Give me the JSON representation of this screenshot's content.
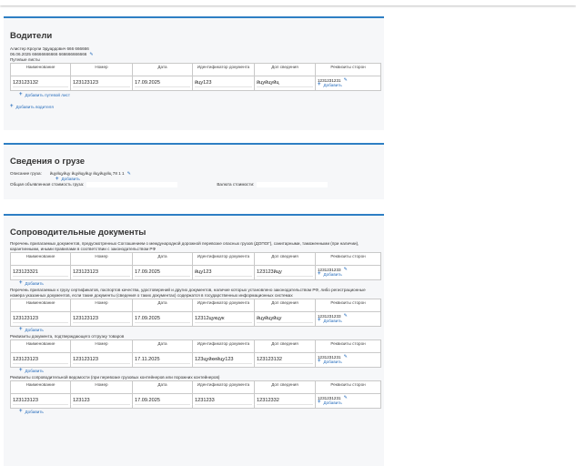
{
  "drivers": {
    "title": "Водители",
    "driver_name": "Алистер Кроули Эдуардович 666 666666",
    "driver_details": "06.06.2025 66666666666 666666666666",
    "waybills_label": "Путевые листы",
    "columns": [
      "Наименование",
      "Номер",
      "Дата",
      "Идентификатор документа",
      "Доп сведения",
      "Реквизиты сторон"
    ],
    "rows": [
      {
        "name": "123123132",
        "number": "123123123",
        "date": "17.09.2025",
        "ident": "йцу123",
        "extra": "йцуйцуйц",
        "req": "1231231231"
      }
    ],
    "add_inline": "Добавить",
    "add_waybill": "Добавить путевой лист",
    "add_driver": "Добавить водителя"
  },
  "cargo": {
    "title": "Сведения о грузе",
    "desc_label": "Описание груза:",
    "desc_value": "йцуйцуйцу йцуйцуйцу йцуйцуйц 78 1 1",
    "add_link": "Добавить",
    "value_label": "Общая объявленная стоимость груза:",
    "currency_label": "Валюта стоимости:"
  },
  "docs": {
    "title": "Сопроводительные документы",
    "columns": [
      "Наименование",
      "Номер",
      "Дата",
      "Идентификатор документа",
      "Доп сведения",
      "Реквизиты сторон"
    ],
    "add_inline": "Добавить",
    "add_link": "Добавить",
    "groups": [
      {
        "desc": "Перечень прилагаемых документов, предусмотренных Соглашением о международной дорожной перевозке опасных грузов (ДОПОГ), санитарными, таможенными (при наличии), карантинными, иными правилами в соответствии с законодательством РФ",
        "rows": [
          {
            "name": "123123321",
            "number": "123123123",
            "date": "17.09.2025",
            "ident": "йцу123",
            "extra": "123123йцу",
            "req": "1231231233"
          }
        ]
      },
      {
        "desc": "Перечень прилагаемых к грузу сертификатов, паспортов качества, удостоверений и других документов, наличие которых установлено законодательством РФ, либо регистрационные номера указанных документов, если такие документы (сведения о таких документах) содержатся в государственных информационных системах",
        "rows": [
          {
            "name": "123123123",
            "number": "123123123",
            "date": "17.09.2025",
            "ident": "12312цукцук",
            "extra": "йцуйцуйцу",
            "req": "1231231233"
          }
        ]
      },
      {
        "desc": "Реквизиты документа, подтверждающего отгрузку товаров",
        "rows": [
          {
            "name": "123123123",
            "number": "123123123",
            "date": "17.11.2025",
            "ident": "123цуйкейцу123",
            "extra": "123123132",
            "req": "1231231231"
          }
        ]
      },
      {
        "desc": "Реквизиты сопроводительной ведомости (при перевозке грузовых контейнеров или порожних контейнеров)",
        "rows": [
          {
            "name": "123123123",
            "number": "123123",
            "date": "17.09.2025",
            "ident": "1231233",
            "extra": "12312332",
            "req": "1231231231"
          }
        ]
      }
    ]
  },
  "colors": {
    "accent": "#2e7fc4",
    "link": "#2a6fbd",
    "card": "#f6f7f9"
  },
  "icons": {
    "edit": "pencil-icon",
    "add": "plus-icon"
  }
}
